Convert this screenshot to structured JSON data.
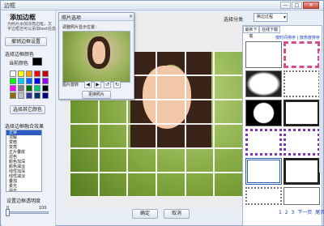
{
  "window": {
    "title": "边框",
    "min": "—",
    "max": "□",
    "close": "✕"
  },
  "left": {
    "heading": "添加边框",
    "desc_line1": "为照片添加漂亮边框，文",
    "desc_line2": "字边框还可以添加text信息",
    "cancel_border": "撤销边框设置",
    "choose_color": "选择边框颜色",
    "current_color": "当前颜色",
    "current_color_hex": "#000000",
    "palette": [
      "#ffffff",
      "#ffff00",
      "#ff9900",
      "#ff0000",
      "#cc0000",
      "#00ff00",
      "#00ccff",
      "#0066ff",
      "#0000ff",
      "#9900ff",
      "#ff00ff",
      "#808080",
      "#006600",
      "#00cc66",
      "#000000",
      "#996600",
      "#c0c0c0",
      "#333399",
      "#003366",
      "#000080"
    ],
    "other_color": "选择其它颜色",
    "fusion_label": "选择边框融合效果",
    "effects": [
      "正常",
      "溶解",
      "变暗",
      "变亮",
      "正片叠底",
      "滤色",
      "颜色加深",
      "颜色减淡",
      "线性加深",
      "线性减淡",
      "叠加",
      "柔光",
      "强光",
      "亮光"
    ],
    "selected_effect_index": 0,
    "transparency_label": "设置边框透明度",
    "slider_min": "0",
    "slider_max": "100",
    "transparency_value": 0
  },
  "dialog": {
    "title": "照片选项",
    "close": "✕",
    "prompt": "调整照片显示位置：",
    "rotate_label": "图片旋转",
    "rotate_buttons": [
      "◀",
      "▶",
      "↺",
      "↻"
    ],
    "change_photo": "更换照片"
  },
  "footer": {
    "ok": "确定",
    "cancel": "取消"
  },
  "right": {
    "category_label": "选择分类",
    "category_value": "撕边过程",
    "category_arrow": "▾",
    "tabs": [
      "最新下载",
      "在线下载"
    ],
    "sort_link": "按时间排序 | 按热度排序",
    "pages": [
      "1",
      "2",
      "3",
      "下一页",
      "尾页"
    ]
  },
  "colors": {
    "accent": "#2b5cc0",
    "link": "#1a3fbf"
  }
}
